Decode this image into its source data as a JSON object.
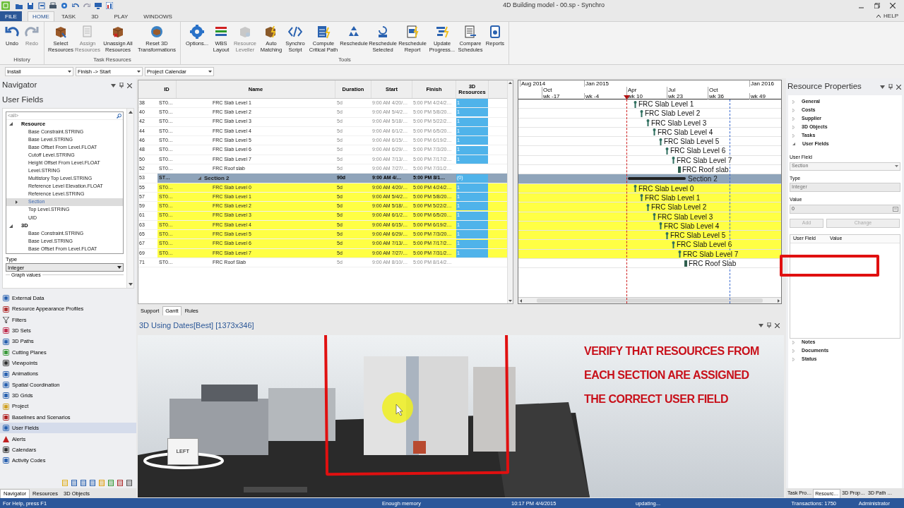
{
  "window": {
    "title": "4D Building model - 00.sp - Synchro"
  },
  "menu_tabs": [
    {
      "label": "FILE",
      "kind": "file",
      "selected": false
    },
    {
      "label": "HOME",
      "kind": "tab",
      "selected": true
    },
    {
      "label": "TASK",
      "kind": "tab",
      "selected": false
    },
    {
      "label": "3D",
      "kind": "tab",
      "selected": false
    },
    {
      "label": "PLAY",
      "kind": "tab",
      "selected": false
    },
    {
      "label": "WINDOWS",
      "kind": "tab",
      "selected": false
    }
  ],
  "help": "HELP",
  "ribbon": {
    "groups": [
      {
        "label": "History",
        "buttons": [
          {
            "label": "Undo",
            "disabled": false
          },
          {
            "label": "Redo",
            "disabled": true
          }
        ]
      },
      {
        "label": "Task Resources",
        "buttons": [
          {
            "label": "Select Resources",
            "disabled": false
          },
          {
            "label": "Assign Resources",
            "disabled": true
          },
          {
            "label": "Unassign All Resources",
            "disabled": false
          },
          {
            "label": "Reset 3D Transformations",
            "disabled": false
          }
        ]
      },
      {
        "label": "Tools",
        "buttons": [
          {
            "label": "Options...",
            "disabled": false
          },
          {
            "label": "WBS Layout",
            "disabled": false
          },
          {
            "label": "Resource Leveller",
            "disabled": true
          },
          {
            "label": "Auto Matching",
            "disabled": false
          },
          {
            "label": "Synchro Script",
            "disabled": false
          },
          {
            "label": "Compute Critical Path",
            "disabled": false
          },
          {
            "label": "Reschedule",
            "disabled": false
          },
          {
            "label": "Reschedule Selected",
            "disabled": false
          },
          {
            "label": "Reschedule Report",
            "disabled": false
          },
          {
            "label": "Update Progress...",
            "disabled": false
          },
          {
            "label": "Compare Schedules",
            "disabled": false
          },
          {
            "label": "Reports",
            "disabled": false
          }
        ]
      }
    ]
  },
  "toolbar": {
    "dropdowns": [
      {
        "value": "Install"
      },
      {
        "value": "Finish -> Start"
      },
      {
        "value": "Project Calendar"
      }
    ]
  },
  "navigator": {
    "title": "Navigator",
    "heading": "User Fields",
    "filter": "<all>",
    "groups": [
      {
        "label": "Resource",
        "expanded": true,
        "children": [
          {
            "label": "Base Constraint.STRING",
            "selected": false
          },
          {
            "label": "Base Level.STRING",
            "selected": false
          },
          {
            "label": "Base Offset From Level.FLOAT",
            "selected": false
          },
          {
            "label": "Cutoff Level.STRING",
            "selected": false
          },
          {
            "label": "Height Offset From Level.FLOAT",
            "selected": false
          },
          {
            "label": "Level.STRING",
            "selected": false
          },
          {
            "label": "Multistory Top Level.STRING",
            "selected": false
          },
          {
            "label": "Reference Level Elevation.FLOAT",
            "selected": false
          },
          {
            "label": "Reference Level.STRING",
            "selected": false
          },
          {
            "label": "Section",
            "selected": true
          },
          {
            "label": "Top Level.STRING",
            "selected": false
          },
          {
            "label": "UID",
            "selected": false
          }
        ]
      },
      {
        "label": "3D",
        "expanded": true,
        "children": [
          {
            "label": "Base Constraint.STRING",
            "selected": false
          },
          {
            "label": "Base Level.STRING",
            "selected": false
          },
          {
            "label": "Base Offset From Level.FLOAT",
            "selected": false
          }
        ]
      }
    ],
    "type_label": "Type",
    "type_value": "Integer",
    "graph_values": "Graph values",
    "items": [
      {
        "label": "External Data",
        "selected": false
      },
      {
        "label": "Resource Appearance Profiles",
        "selected": false
      },
      {
        "label": "Filters",
        "selected": false
      },
      {
        "label": "3D Sets",
        "selected": false
      },
      {
        "label": "3D Paths",
        "selected": false
      },
      {
        "label": "Cutting Planes",
        "selected": false
      },
      {
        "label": "Viewpoints",
        "selected": false
      },
      {
        "label": "Animations",
        "selected": false
      },
      {
        "label": "Spatial Coordination",
        "selected": false
      },
      {
        "label": "3D Grids",
        "selected": false
      },
      {
        "label": "Project",
        "selected": false
      },
      {
        "label": "Baselines and Scenarios",
        "selected": false
      },
      {
        "label": "User Fields",
        "selected": true
      },
      {
        "label": "Alerts",
        "selected": false
      },
      {
        "label": "Calendars",
        "selected": false
      },
      {
        "label": "Activity Codes",
        "selected": false
      }
    ],
    "tabs": [
      {
        "label": "Navigator",
        "selected": true
      },
      {
        "label": "Resources",
        "selected": false
      },
      {
        "label": "3D Objects",
        "selected": false
      }
    ]
  },
  "table": {
    "columns": [
      "ID",
      "Name",
      "Duration",
      "Start",
      "Finish",
      "3D Resources"
    ],
    "rows": [
      {
        "row": "38",
        "id": "ST0…",
        "name": "FRC Slab Level 1",
        "duration": "5d",
        "start": "9:00 AM 4/20/…",
        "finish": "5:00 PM 4/24/2…",
        "resources": "1",
        "kind": "task",
        "highlighted": false
      },
      {
        "row": "40",
        "id": "ST0…",
        "name": "FRC Slab Level 2",
        "duration": "5d",
        "start": "9:00 AM 5/4/2…",
        "finish": "5:00 PM 5/8/20…",
        "resources": "1",
        "kind": "task",
        "highlighted": false
      },
      {
        "row": "42",
        "id": "ST0…",
        "name": "FRC Slab Level 3",
        "duration": "5d",
        "start": "9:00 AM 5/18/…",
        "finish": "5:00 PM 5/22/2…",
        "resources": "1",
        "kind": "task",
        "highlighted": false
      },
      {
        "row": "44",
        "id": "ST0…",
        "name": "FRC Slab Level 4",
        "duration": "5d",
        "start": "9:00 AM 6/1/2…",
        "finish": "5:00 PM 6/5/20…",
        "resources": "1",
        "kind": "task",
        "highlighted": false
      },
      {
        "row": "46",
        "id": "ST0…",
        "name": "FRC Slab Level 5",
        "duration": "5d",
        "start": "9:00 AM 6/15/…",
        "finish": "5:00 PM 6/19/2…",
        "resources": "1",
        "kind": "task",
        "highlighted": false
      },
      {
        "row": "48",
        "id": "ST0…",
        "name": "FRC Slab Level 6",
        "duration": "5d",
        "start": "9:00 AM 6/29/…",
        "finish": "5:00 PM 7/3/20…",
        "resources": "1",
        "kind": "task",
        "highlighted": false
      },
      {
        "row": "50",
        "id": "ST0…",
        "name": "FRC Slab Level 7",
        "duration": "5d",
        "start": "9:00 AM 7/13/…",
        "finish": "5:00 PM 7/17/2…",
        "resources": "1",
        "kind": "task",
        "highlighted": false
      },
      {
        "row": "52",
        "id": "ST0…",
        "name": "FRC Roof slab",
        "duration": "5d",
        "start": "9:00 AM 7/27/…",
        "finish": "5:00 PM 7/31/2…",
        "kind": "task",
        "highlighted": false
      },
      {
        "row": "53",
        "id": "ST…",
        "name": "Section 2",
        "duration": "90d",
        "start": "9:00 AM 4/…",
        "finish": "5:00 PM 8/1…",
        "resources": "(0)",
        "kind": "summary",
        "highlighted": false
      },
      {
        "row": "55",
        "id": "ST0…",
        "name": "FRC Slab Level 0",
        "duration": "5d",
        "start": "9:00 AM 4/20/…",
        "finish": "5:00 PM 4/24/2…",
        "resources": "1",
        "kind": "task",
        "highlighted": true
      },
      {
        "row": "57",
        "id": "ST0…",
        "name": "FRC Slab Level 1",
        "duration": "5d",
        "start": "9:00 AM 5/4/2…",
        "finish": "5:00 PM 5/8/20…",
        "resources": "1",
        "kind": "task",
        "highlighted": true
      },
      {
        "row": "59",
        "id": "ST0…",
        "name": "FRC Slab Level 2",
        "duration": "5d",
        "start": "9:00 AM 5/18/…",
        "finish": "5:00 PM 5/22/2…",
        "resources": "1",
        "kind": "task",
        "highlighted": true
      },
      {
        "row": "61",
        "id": "ST0…",
        "name": "FRC Slab Level 3",
        "duration": "5d",
        "start": "9:00 AM 6/1/2…",
        "finish": "5:00 PM 6/5/20…",
        "resources": "1",
        "kind": "task",
        "highlighted": true
      },
      {
        "row": "63",
        "id": "ST0…",
        "name": "FRC Slab Level 4",
        "duration": "5d",
        "start": "9:00 AM 6/15/…",
        "finish": "5:00 PM 6/19/2…",
        "resources": "1",
        "kind": "task",
        "highlighted": true
      },
      {
        "row": "65",
        "id": "ST0…",
        "name": "FRC Slab Level 5",
        "duration": "5d",
        "start": "9:00 AM 6/29/…",
        "finish": "5:00 PM 7/3/20…",
        "resources": "1",
        "kind": "task",
        "highlighted": true
      },
      {
        "row": "67",
        "id": "ST0…",
        "name": "FRC Slab Level 6",
        "duration": "5d",
        "start": "9:00 AM 7/13/…",
        "finish": "5:00 PM 7/17/2…",
        "resources": "1",
        "kind": "task",
        "highlighted": true
      },
      {
        "row": "69",
        "id": "ST0…",
        "name": "FRC Slab Level 7",
        "duration": "5d",
        "start": "9:00 AM 7/27/…",
        "finish": "5:00 PM 7/31/2…",
        "resources": "1",
        "kind": "task",
        "highlighted": true
      },
      {
        "row": "71",
        "id": "ST0…",
        "name": "FRC Roof Slab",
        "duration": "5d",
        "start": "9:00 AM 8/10/…",
        "finish": "5:00 PM 8/14/2…",
        "kind": "task",
        "highlighted": false
      }
    ]
  },
  "view_tabs": [
    {
      "label": "Support",
      "selected": false
    },
    {
      "label": "Gantt",
      "selected": true
    },
    {
      "label": "Rules",
      "selected": false
    }
  ],
  "gantt": {
    "years": [
      "Aug 2014",
      "Jan 2015",
      "Jan 2016"
    ],
    "months": [
      "Oct",
      "Apr",
      "Jul",
      "Oct"
    ],
    "weeks": [
      "wk -17",
      "wk -4",
      "wk 10",
      "wk 23",
      "wk 36",
      "wk 49"
    ],
    "rows": [
      {
        "label": "FRC Slab Level 1",
        "kind": "task",
        "highlighted": false
      },
      {
        "label": "FRC Slab Level 2",
        "kind": "task",
        "highlighted": false
      },
      {
        "label": "FRC Slab Level 3",
        "kind": "task",
        "highlighted": false
      },
      {
        "label": "FRC Slab Level 4",
        "kind": "task",
        "highlighted": false
      },
      {
        "label": "FRC Slab Level 5",
        "kind": "task",
        "highlighted": false
      },
      {
        "label": "FRC Slab Level 6",
        "kind": "task",
        "highlighted": false
      },
      {
        "label": "FRC Slab Level 7",
        "kind": "task",
        "highlighted": false
      },
      {
        "label": "FRC Roof slab",
        "kind": "end",
        "highlighted": false
      },
      {
        "label": "Section 2",
        "kind": "summary",
        "highlighted": false
      },
      {
        "label": "FRC Slab Level 0",
        "kind": "task",
        "highlighted": true
      },
      {
        "label": "FRC Slab Level 1",
        "kind": "task",
        "highlighted": true
      },
      {
        "label": "FRC Slab Level 2",
        "kind": "task",
        "highlighted": true
      },
      {
        "label": "FRC Slab Level 3",
        "kind": "task",
        "highlighted": true
      },
      {
        "label": "FRC Slab Level 4",
        "kind": "task",
        "highlighted": true
      },
      {
        "label": "FRC Slab Level 5",
        "kind": "task",
        "highlighted": true
      },
      {
        "label": "FRC Slab Level 6",
        "kind": "task",
        "highlighted": true
      },
      {
        "label": "FRC Slab Level 7",
        "kind": "task",
        "highlighted": true
      },
      {
        "label": "FRC Roof Slab",
        "kind": "end",
        "highlighted": false
      }
    ]
  },
  "view3d": {
    "title": "3D Using Dates[Best] [1373x346]",
    "cube_label": "LEFT",
    "annotation_lines": [
      "VERIFY THAT RESOURCES FROM",
      "EACH SECTION ARE ASSIGNED",
      "THE CORRECT USER FIELD"
    ]
  },
  "properties": {
    "title": "Resource Properties",
    "sections": [
      {
        "label": "General",
        "expanded": false
      },
      {
        "label": "Costs",
        "expanded": false
      },
      {
        "label": "Supplier",
        "expanded": false
      },
      {
        "label": "3D Objects",
        "expanded": false
      },
      {
        "label": "Tasks",
        "expanded": false
      },
      {
        "label": "User Fields",
        "expanded": true
      }
    ],
    "user_field_label": "User Field",
    "user_field": "Section",
    "type_label": "Type",
    "type": "Integer",
    "value_label": "Value",
    "value": "0",
    "buttons": [
      {
        "label": "Add",
        "disabled": true
      },
      {
        "label": "Change",
        "disabled": true
      }
    ],
    "grid_columns": [
      "User Field",
      "Value"
    ],
    "more_sections": [
      {
        "label": "Notes",
        "expanded": false
      },
      {
        "label": "Documents",
        "expanded": false
      },
      {
        "label": "Status",
        "expanded": false
      }
    ],
    "tabs": [
      {
        "label": "Task Pro…",
        "selected": false
      },
      {
        "label": "Resourc…",
        "selected": true
      },
      {
        "label": "3D Prop…",
        "selected": false
      },
      {
        "label": "3D Path …",
        "selected": false
      }
    ]
  },
  "status_bar": [
    "For Help, press F1",
    "Enough memory",
    "10:17 PM 4/4/2015",
    "updating...",
    "Transactions: 1750",
    "Administrator"
  ]
}
